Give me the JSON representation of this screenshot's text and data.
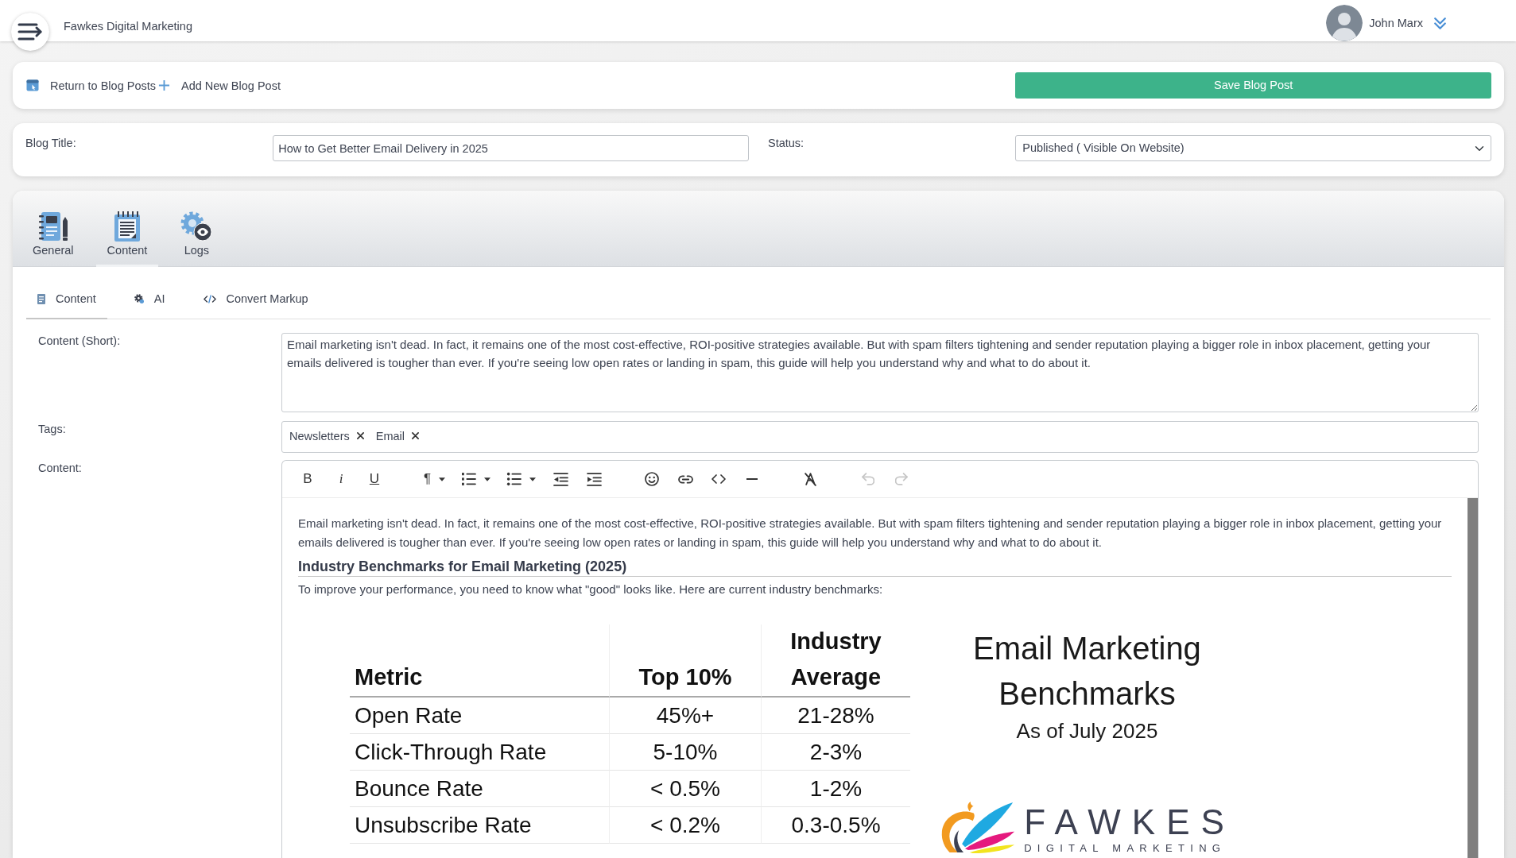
{
  "header": {
    "brand": "Fawkes Digital Marketing",
    "user_name": "John Marx"
  },
  "action_bar": {
    "links": [
      {
        "kind": "return",
        "label": "Return to Blog Posts"
      },
      {
        "kind": "add",
        "label": "Add New Blog Post"
      }
    ],
    "save_button": "Save Blog Post"
  },
  "post_settings": {
    "title_label": "Blog Title:",
    "title_value": "How to Get Better Email Delivery in 2025",
    "status_label": "Status:",
    "status_value": "Published ( Visible On Website)"
  },
  "main_tabs": [
    {
      "kind": "general",
      "label": "General",
      "selected": false
    },
    {
      "kind": "content",
      "label": "Content",
      "selected": true
    },
    {
      "kind": "logs",
      "label": "Logs",
      "selected": false
    }
  ],
  "sub_tabs": [
    {
      "kind": "content",
      "label": "Content",
      "selected": true
    },
    {
      "kind": "ai",
      "label": "AI",
      "selected": false
    },
    {
      "kind": "code",
      "label": "Convert Markup",
      "selected": false
    }
  ],
  "form": {
    "short_label": "Content (Short):",
    "short_value": "Email marketing isn't dead. In fact, it remains one of the most cost-effective, ROI-positive strategies available. But with spam filters tightening and sender reputation playing a bigger role in inbox placement, getting your emails delivered is tougher than ever. If you're seeing low open rates or landing in spam, this guide will help you understand why and what to do about it.",
    "tags_label": "Tags:",
    "tags": [
      "Newsletters",
      "Email"
    ],
    "content_label": "Content:"
  },
  "editor": {
    "toolbar_groups": [
      [
        {
          "kind": "bold",
          "label": "B",
          "dropdown": false,
          "disabled": false
        },
        {
          "kind": "italic",
          "label": "i",
          "dropdown": false,
          "disabled": false
        },
        {
          "kind": "underline",
          "label": "U",
          "dropdown": false,
          "disabled": false
        }
      ],
      [
        {
          "kind": "paragraph",
          "label": "¶",
          "dropdown": true,
          "disabled": false
        },
        {
          "kind": "ordered_list",
          "dropdown": true,
          "disabled": false
        },
        {
          "kind": "bullet_list",
          "dropdown": true,
          "disabled": false
        },
        {
          "kind": "outdent",
          "dropdown": false,
          "disabled": false
        },
        {
          "kind": "indent",
          "dropdown": false,
          "disabled": false
        }
      ],
      [
        {
          "kind": "emoji",
          "dropdown": false,
          "disabled": false
        },
        {
          "kind": "link",
          "dropdown": false,
          "disabled": false
        },
        {
          "kind": "code",
          "dropdown": false,
          "disabled": false
        },
        {
          "kind": "rule",
          "dropdown": false,
          "disabled": false
        }
      ],
      [
        {
          "kind": "clear_format",
          "dropdown": false,
          "disabled": false
        }
      ],
      [
        {
          "kind": "undo",
          "dropdown": false,
          "disabled": true
        },
        {
          "kind": "redo",
          "dropdown": false,
          "disabled": true
        }
      ]
    ],
    "blocks": [
      {
        "kind": "paragraph",
        "text": "Email marketing isn't dead. In fact, it remains one of the most cost-effective, ROI-positive strategies available. But with spam filters tightening and sender reputation playing a bigger role in inbox placement, getting your emails delivered is tougher than ever. If you're seeing low open rates or landing in spam, this guide will help you understand why and what to do about it."
      },
      {
        "kind": "heading",
        "text": "Industry Benchmarks for Email Marketing (2025)"
      },
      {
        "kind": "paragraph",
        "text": "To improve your performance, you need to know what \"good\" looks like. Here are current industry benchmarks:"
      },
      {
        "kind": "infographic",
        "table": {
          "columns": [
            "Metric",
            "Top 10%",
            "Industry Average"
          ],
          "rows": [
            [
              "Open Rate",
              "45%+",
              "21-28%"
            ],
            [
              "Click-Through Rate",
              "5-10%",
              "2-3%"
            ],
            [
              "Bounce Rate",
              "< 0.5%",
              "1-2%"
            ],
            [
              "Unsubscribe Rate",
              "< 0.2%",
              "0.3-0.5%"
            ]
          ]
        },
        "title": "Email Marketing Benchmarks",
        "subtitle": "As of July 2025",
        "logo": {
          "wordmark": "FAWKES",
          "tagline": "DIGITAL MARKETING"
        }
      }
    ]
  }
}
